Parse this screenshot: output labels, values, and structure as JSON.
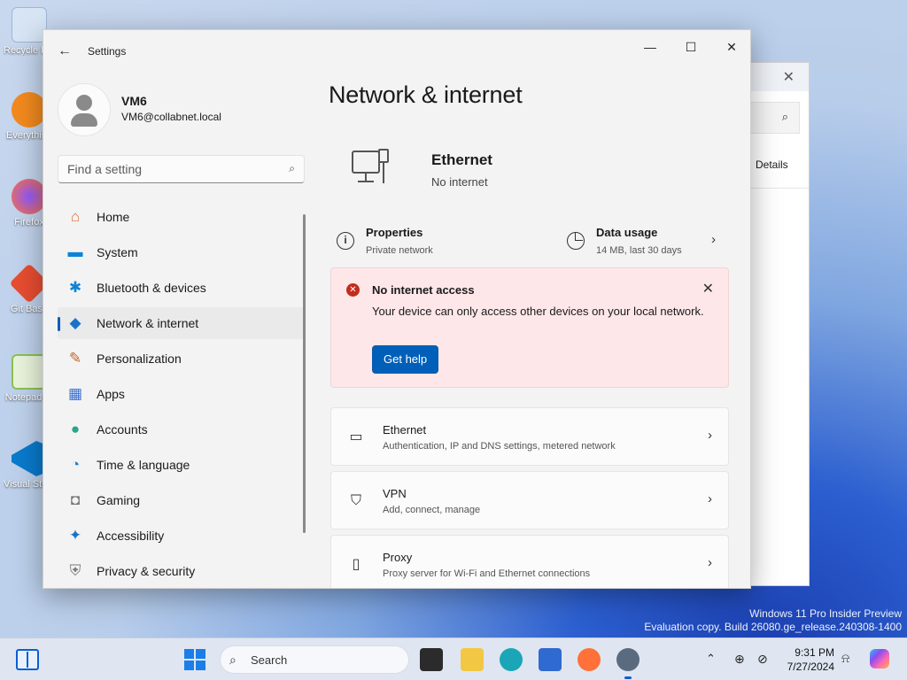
{
  "desktop": {
    "icons": [
      {
        "label": "Recycle Bin",
        "icon": "recycle-bin-icon",
        "color": "#d7e5f5"
      },
      {
        "label": "Everything",
        "icon": "everything-icon",
        "color": "#f28a1e"
      },
      {
        "label": "Firefox",
        "icon": "firefox-icon",
        "color": "#ff7139"
      },
      {
        "label": "Git Bash",
        "icon": "git-bash-icon",
        "color": "#e84d31"
      },
      {
        "label": "Notepad++",
        "icon": "notepadpp-icon",
        "color": "#8cc152"
      },
      {
        "label": "Visual Studio Code",
        "icon": "vscode-icon",
        "color": "#0a7acc"
      }
    ],
    "watermark_line1": "Windows 11 Pro Insider Preview",
    "watermark_line2": "Evaluation copy. Build 26080.ge_release.240308-1400"
  },
  "background_window": {
    "details_label": "Details"
  },
  "settings": {
    "title": "Settings",
    "back_glyph": "←",
    "minimize_glyph": "—",
    "maximize_glyph": "☐",
    "close_glyph": "✕",
    "profile": {
      "name": "VM6",
      "email": "VM6@collabnet.local"
    },
    "search": {
      "placeholder": "Find a setting",
      "icon": "search-icon"
    },
    "nav": [
      {
        "label": "Home",
        "icon": "home-icon",
        "glyph": "⌂",
        "color": "#d9703a",
        "active": false
      },
      {
        "label": "System",
        "icon": "system-icon",
        "glyph": "▬",
        "color": "#0a84d6",
        "active": false
      },
      {
        "label": "Bluetooth & devices",
        "icon": "bluetooth-icon",
        "glyph": "✱",
        "color": "#0a84d6",
        "active": false
      },
      {
        "label": "Network & internet",
        "icon": "wifi-icon",
        "glyph": "◆",
        "color": "#1a73c9",
        "active": true
      },
      {
        "label": "Personalization",
        "icon": "brush-icon",
        "glyph": "✎",
        "color": "#c4642c",
        "active": false
      },
      {
        "label": "Apps",
        "icon": "apps-icon",
        "glyph": "▦",
        "color": "#3a6fd0",
        "active": false
      },
      {
        "label": "Accounts",
        "icon": "accounts-icon",
        "glyph": "●",
        "color": "#2ba58a",
        "active": false
      },
      {
        "label": "Time & language",
        "icon": "globe-clock-icon",
        "glyph": "◔",
        "color": "#1d83c8",
        "active": false
      },
      {
        "label": "Gaming",
        "icon": "gamepad-icon",
        "glyph": "◘",
        "color": "#777777",
        "active": false
      },
      {
        "label": "Accessibility",
        "icon": "accessibility-icon",
        "glyph": "✦",
        "color": "#1a73c9",
        "active": false
      },
      {
        "label": "Privacy & security",
        "icon": "shield-icon",
        "glyph": "⛨",
        "color": "#777777",
        "active": false
      }
    ],
    "page_title": "Network & internet",
    "hero": {
      "title": "Ethernet",
      "status": "No internet"
    },
    "properties": {
      "title": "Properties",
      "subtitle": "Private network"
    },
    "data_usage": {
      "title": "Data usage",
      "subtitle": "14 MB, last 30 days"
    },
    "alert": {
      "title": "No internet access",
      "body": "Your device can only access other devices on your local network.",
      "button": "Get help",
      "color": "#c42b1c"
    },
    "cards": [
      {
        "title": "Ethernet",
        "subtitle": "Authentication, IP and DNS settings, metered network",
        "icon": "ethernet-icon",
        "glyph": "▭"
      },
      {
        "title": "VPN",
        "subtitle": "Add, connect, manage",
        "icon": "vpn-shield-icon",
        "glyph": "⛉"
      },
      {
        "title": "Proxy",
        "subtitle": "Proxy server for Wi-Fi and Ethernet connections",
        "icon": "proxy-icon",
        "glyph": "▯"
      }
    ],
    "accent": "#005fb8"
  },
  "taskbar": {
    "search_label": "Search",
    "apps": [
      {
        "name": "task-view",
        "color": "#2b2b2b"
      },
      {
        "name": "file-explorer",
        "color": "#f2c744"
      },
      {
        "name": "edge",
        "color": "#1aa6b7"
      },
      {
        "name": "store",
        "color": "#2f6ad0"
      },
      {
        "name": "firefox",
        "color": "#ff7139"
      },
      {
        "name": "settings",
        "color": "#5a6b80"
      }
    ],
    "time": "9:31 PM",
    "date": "7/27/2024"
  }
}
